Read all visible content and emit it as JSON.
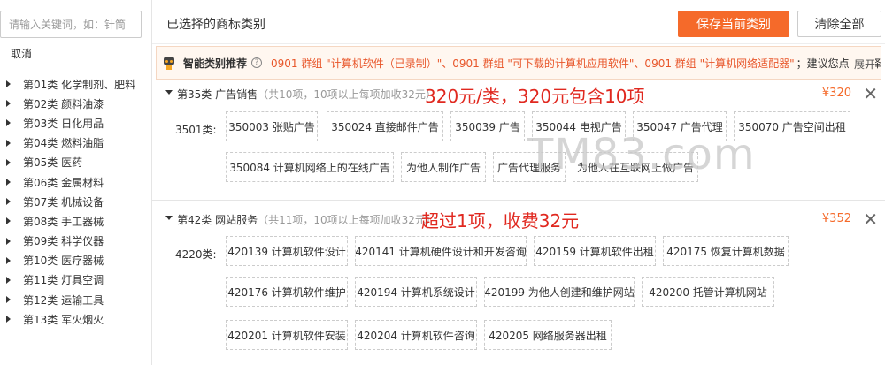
{
  "sidebar": {
    "search_placeholder": "请输入关键词，如：针筒",
    "cancel_label": "取消",
    "categories": [
      {
        "num": "第01类",
        "name": "化学制剂、肥料"
      },
      {
        "num": "第02类",
        "name": "颜料油漆"
      },
      {
        "num": "第03类",
        "name": "日化用品"
      },
      {
        "num": "第04类",
        "name": "燃料油脂"
      },
      {
        "num": "第05类",
        "name": "医药"
      },
      {
        "num": "第06类",
        "name": "金属材料"
      },
      {
        "num": "第07类",
        "name": "机械设备"
      },
      {
        "num": "第08类",
        "name": "手工器械"
      },
      {
        "num": "第09类",
        "name": "科学仪器"
      },
      {
        "num": "第10类",
        "name": "医疗器械"
      },
      {
        "num": "第11类",
        "name": "灯具空调"
      },
      {
        "num": "第12类",
        "name": "运输工具"
      },
      {
        "num": "第13类",
        "name": "军火烟火"
      }
    ]
  },
  "header": {
    "title": "已选择的商标类别",
    "save_label": "保存当前类别",
    "clear_label": "清除全部"
  },
  "recommend": {
    "title": "智能类别推荐",
    "help": "?",
    "text": "0901 群组 \"计算机软件（已录制）\"、0901 群组 \"可下载的计算机应用软件\"、0901 群组 \"计算机网络适配器\"",
    "suffix": "；建议您点击选择",
    "expand_label": "展开"
  },
  "sections": [
    {
      "title": "第35类 广告销售",
      "note": "（共10项，10项以上每项加收32元）",
      "annotation": "320元/类，320元包含10项",
      "price": "¥320",
      "close": "✕",
      "group_label": "3501类:",
      "items": [
        "350003 张贴广告",
        "350024 直接邮件广告",
        "350039 广告",
        "350044 电视广告",
        "350047 广告代理",
        "350070 广告空间出租",
        "350084 计算机网络上的在线广告",
        "为他人制作广告",
        "广告代理服务",
        "为他人在互联网上做广告"
      ]
    },
    {
      "title": "第42类 网站服务",
      "note": "（共11项，10项以上每项加收32元）",
      "annotation": "超过1项，收费32元",
      "price": "¥352",
      "close": "✕",
      "group_label": "4220类:",
      "items": [
        "420139 计算机软件设计",
        "420141 计算机硬件设计和开发咨询",
        "420159 计算机软件出租",
        "420175 恢复计算机数据",
        "420176 计算机软件维护",
        "420194 计算机系统设计",
        "420199 为他人创建和维护网站",
        "420200 托管计算机网站",
        "420201 计算机软件安装",
        "420204 计算机软件咨询",
        "420205 网络服务器出租"
      ]
    }
  ],
  "watermark": "TM83.com",
  "colors": {
    "accent": "#f56a2a",
    "annotation": "#e0281f",
    "recommend_bg": "#fff7f0"
  }
}
